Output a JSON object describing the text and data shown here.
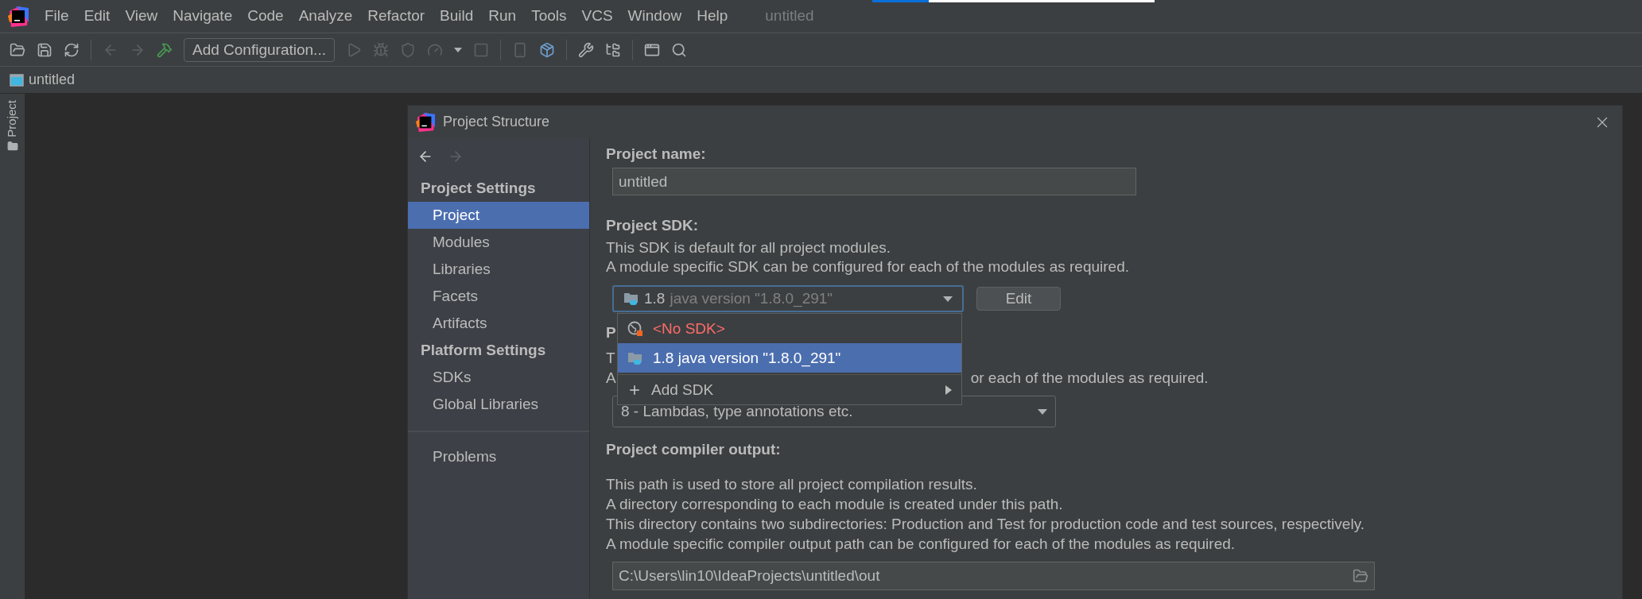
{
  "menu_bar": {
    "items": [
      "File",
      "Edit",
      "View",
      "Navigate",
      "Code",
      "Analyze",
      "Refactor",
      "Build",
      "Run",
      "Tools",
      "VCS",
      "Window",
      "Help"
    ],
    "window_title": "untitled"
  },
  "loading_bar": {
    "level": 0.2
  },
  "toolbar": {
    "run_configuration": "Add Configuration..."
  },
  "breadcrumb": {
    "label": "untitled"
  },
  "tool_window_strip": {
    "label": "Project"
  },
  "dialog": {
    "title": "Project Structure",
    "sidebar": {
      "sections": [
        {
          "heading": "Project Settings",
          "items": [
            {
              "label": "Project",
              "selected": true
            },
            {
              "label": "Modules",
              "selected": false
            },
            {
              "label": "Libraries",
              "selected": false
            },
            {
              "label": "Facets",
              "selected": false
            },
            {
              "label": "Artifacts",
              "selected": false
            }
          ]
        },
        {
          "heading": "Platform Settings",
          "items": [
            {
              "label": "SDKs",
              "selected": false
            },
            {
              "label": "Global Libraries",
              "selected": false
            }
          ]
        },
        {
          "items": [
            {
              "label": "Problems",
              "selected": false
            }
          ]
        }
      ]
    },
    "project_name": {
      "label": "Project name:",
      "value": "untitled"
    },
    "project_sdk": {
      "label": "Project SDK:",
      "description": [
        "This SDK is default for all project modules.",
        "A module specific SDK can be configured for each of the modules as required."
      ],
      "name": "1.8",
      "detail": "java version \"1.8.0_291\"",
      "edit_button": "Edit",
      "popup": [
        {
          "kind": "none",
          "label": "<No SDK>",
          "selected": false
        },
        {
          "kind": "sdk",
          "label": "1.8 java version \"1.8.0_291\"",
          "selected": true
        },
        {
          "kind": "action",
          "label": "Add SDK",
          "selected": false
        }
      ]
    },
    "language_level": {
      "label": "P",
      "description": [
        "T",
        "A"
      ],
      "description_tail": "or each of the modules as required.",
      "value": "8 - Lambdas, type annotations etc."
    },
    "compiler_output": {
      "label": "Project compiler output:",
      "description": [
        "This path is used to store all project compilation results.",
        "A directory corresponding to each module is created under this path.",
        "This directory contains two subdirectories: Production and Test for production code and test sources, respectively.",
        "A module specific compiler output path can be configured for each of the modules as required."
      ],
      "value": "C:\\Users\\lin10\\IdeaProjects\\untitled\\out"
    }
  }
}
